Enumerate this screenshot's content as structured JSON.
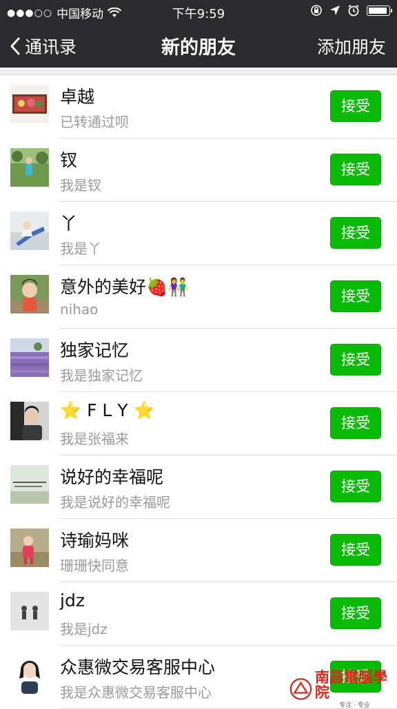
{
  "status": {
    "carrier": "中国移动",
    "time": "下午9:59"
  },
  "nav": {
    "back_label": "通讯录",
    "title": "新的朋友",
    "add_label": "添加朋友"
  },
  "accept_label": "接受",
  "requests": [
    {
      "name": "卓越",
      "message": "已转通过呗"
    },
    {
      "name": "钗",
      "message": "我是钗"
    },
    {
      "name": "丫",
      "message": "我是丫"
    },
    {
      "name": "意外的美好",
      "name_suffix": "🍓👫",
      "message": "nihao"
    },
    {
      "name": "独家记忆",
      "message": "我是独家记忆"
    },
    {
      "name": "F L Y",
      "message": "我是张福来"
    },
    {
      "name": "说好的幸福呢",
      "message": "我是说好的幸福呢"
    },
    {
      "name": "诗瑜妈咪",
      "message": "珊珊快同意"
    },
    {
      "name": "jdz",
      "message": "我是jdz"
    },
    {
      "name": "众惠微交易客服中心",
      "message": "我是众惠微交易客服中心"
    }
  ],
  "watermark": {
    "title": "南昌電腦學院",
    "subtitle": "专注 · 专业"
  },
  "colors": {
    "bar": "#2b2b2e",
    "accept_green": "#09bb07"
  }
}
